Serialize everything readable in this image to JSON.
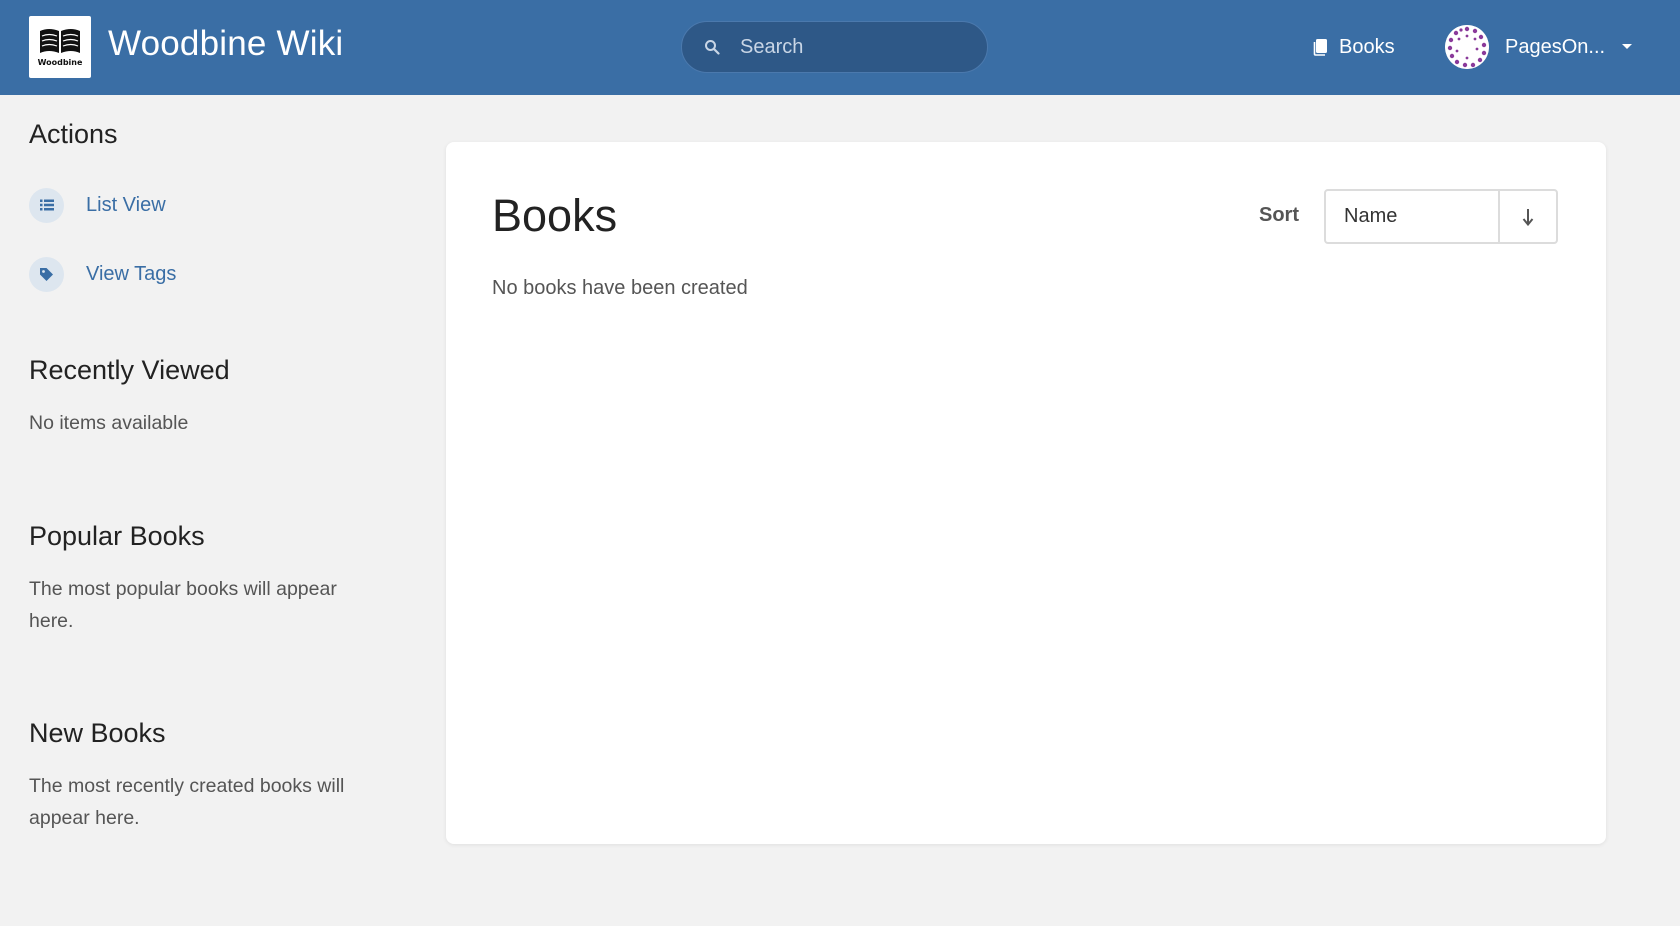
{
  "header": {
    "logo_text": "Woodbine",
    "site_title": "Woodbine Wiki",
    "search_placeholder": "Search",
    "nav_books_label": "Books",
    "user_name": "PagesOn...",
    "bg_color": "#3a6ea5"
  },
  "sidebar": {
    "actions_heading": "Actions",
    "actions": [
      {
        "label": "List View",
        "icon": "list-icon"
      },
      {
        "label": "View Tags",
        "icon": "tag-icon"
      }
    ],
    "recently_viewed_heading": "Recently Viewed",
    "recently_viewed_text": "No items available",
    "popular_heading": "Popular Books",
    "popular_text": "The most popular books will appear here.",
    "new_heading": "New Books",
    "new_text": "The most recently created books will appear here."
  },
  "main": {
    "title": "Books",
    "empty_message": "No books have been created",
    "sort_label": "Sort",
    "sort_value": "Name",
    "sort_direction_icon": "arrow-down-icon"
  }
}
